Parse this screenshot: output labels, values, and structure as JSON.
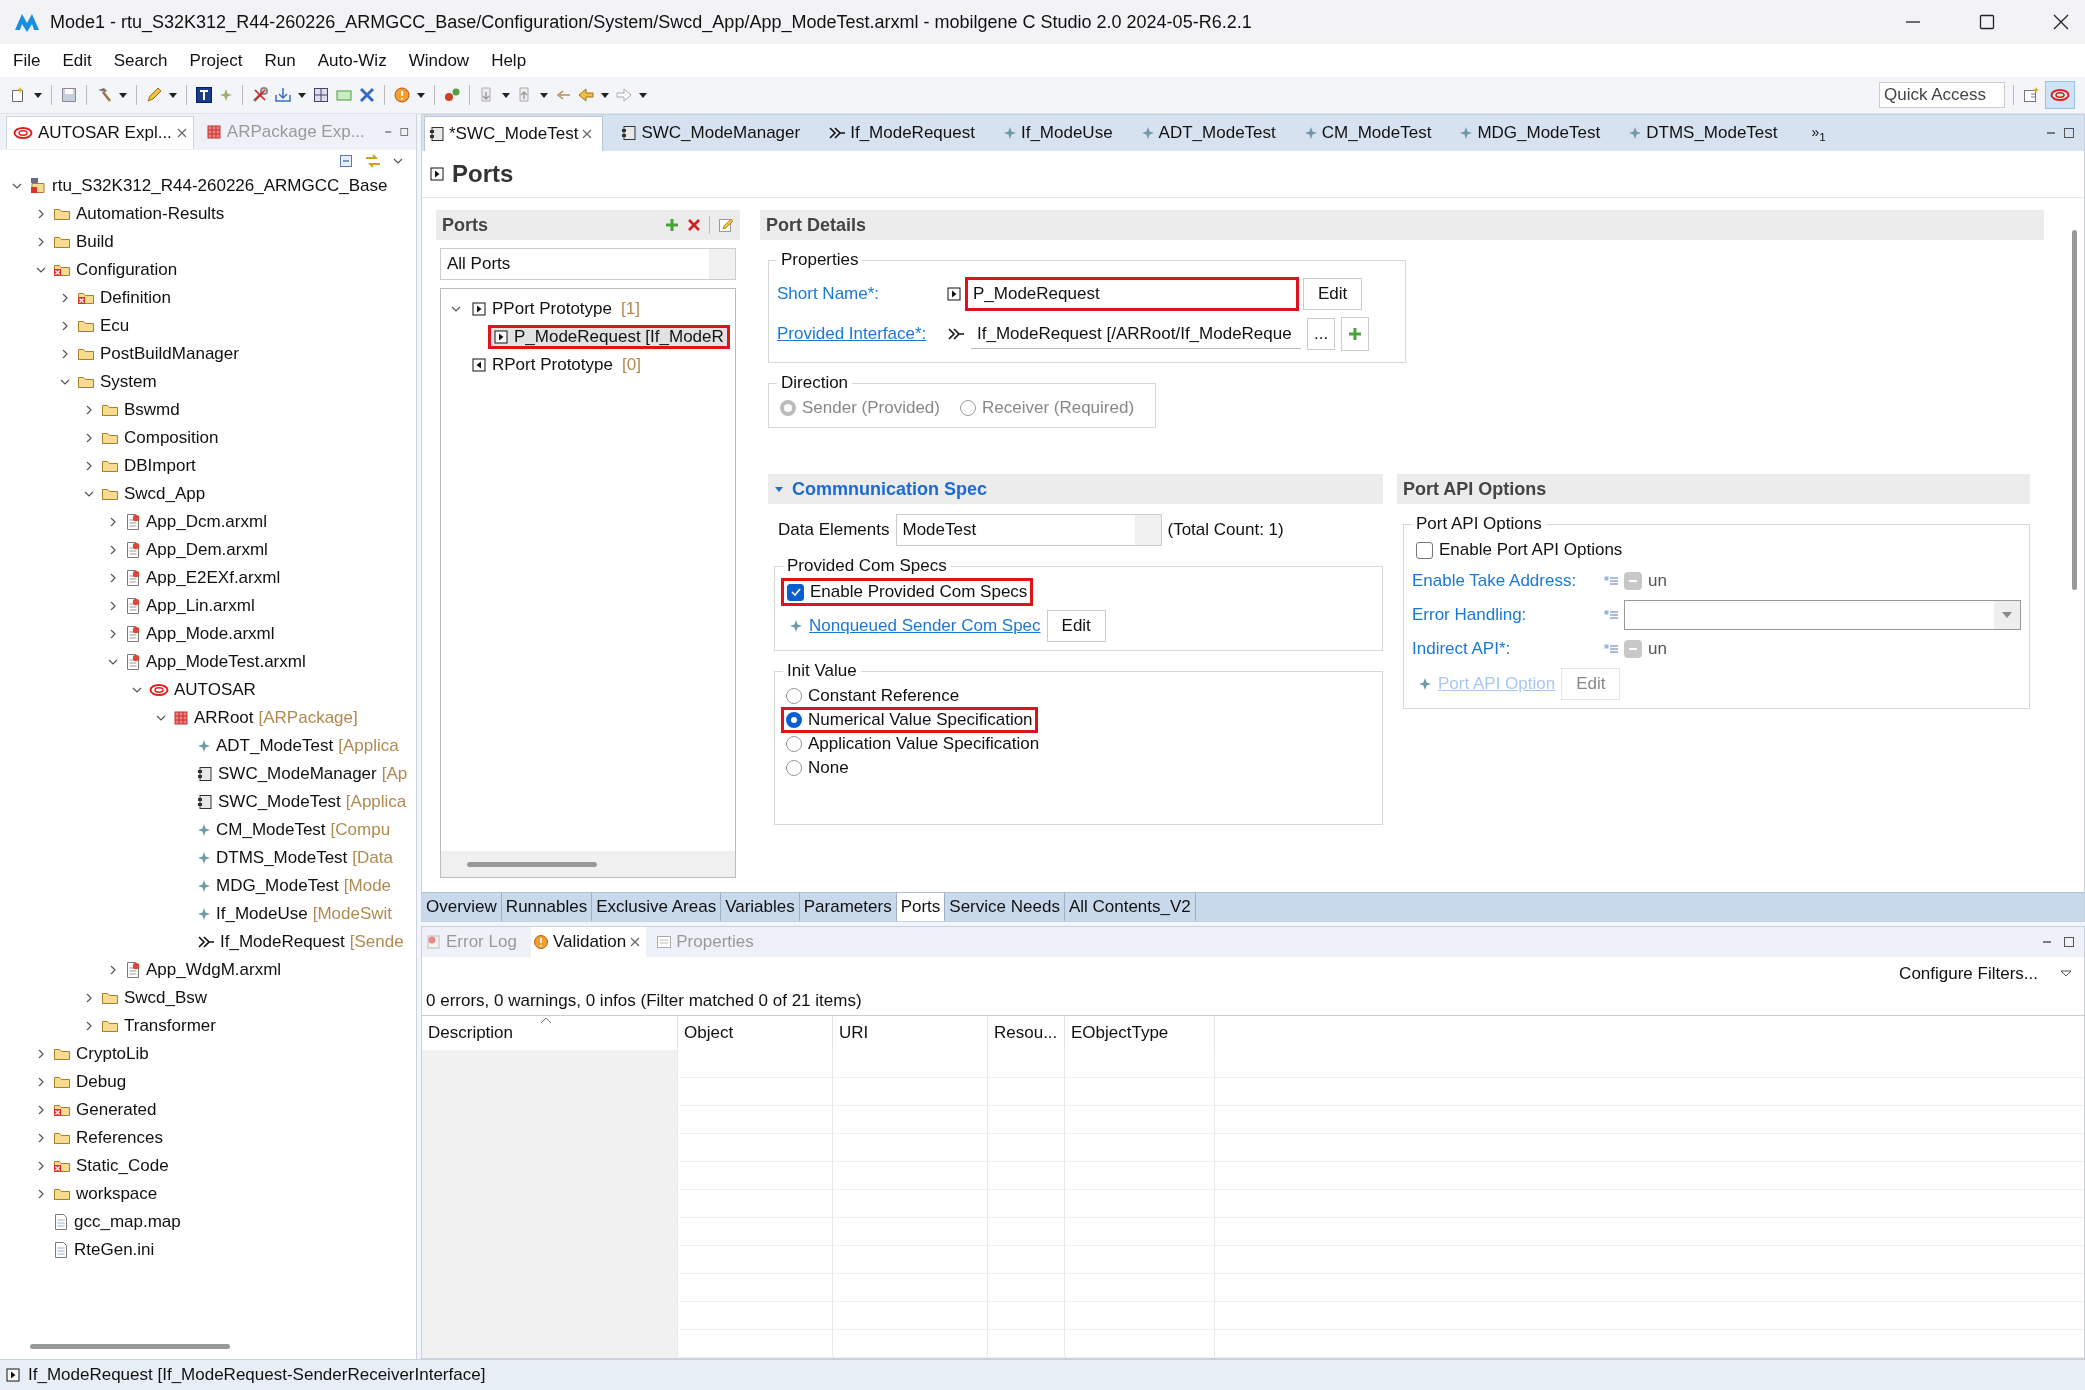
{
  "window": {
    "title": "Mode1 - rtu_S32K312_R44-260226_ARMGCC_Base/Configuration/System/Swcd_App/App_ModeTest.arxml - mobilgene C Studio 2.0 2024-05-R6.2.1"
  },
  "menu": [
    "File",
    "Edit",
    "Search",
    "Project",
    "Run",
    "Auto-Wiz",
    "Window",
    "Help"
  ],
  "quick_access": {
    "placeholder": "Quick Access"
  },
  "explorer": {
    "tabs": [
      {
        "label": "AUTOSAR Expl...",
        "kind": "autosar",
        "selected": true
      },
      {
        "label": "ARPackage Exp...",
        "kind": "package",
        "selected": false
      }
    ],
    "tree": [
      {
        "label": "rtu_S32K312_R44-260226_ARMGCC_Base",
        "kind": "project",
        "expanded": true,
        "children": [
          {
            "label": "Automation-Results",
            "kind": "folder",
            "expanded": false
          },
          {
            "label": "Build",
            "kind": "folder",
            "expanded": false
          },
          {
            "label": "Configuration",
            "kind": "folder-red",
            "expanded": true,
            "children": [
              {
                "label": "Definition",
                "kind": "folder-red",
                "expanded": false
              },
              {
                "label": "Ecu",
                "kind": "folder",
                "expanded": false
              },
              {
                "label": "PostBuildManager",
                "kind": "folder",
                "expanded": false
              },
              {
                "label": "System",
                "kind": "folder",
                "expanded": true,
                "children": [
                  {
                    "label": "Bswmd",
                    "kind": "folder",
                    "expanded": false
                  },
                  {
                    "label": "Composition",
                    "kind": "folder",
                    "expanded": false
                  },
                  {
                    "label": "DBImport",
                    "kind": "folder",
                    "expanded": false
                  },
                  {
                    "label": "Swcd_App",
                    "kind": "folder",
                    "expanded": true,
                    "children": [
                      {
                        "label": "App_Dcm.arxml",
                        "kind": "file",
                        "expanded": false
                      },
                      {
                        "label": "App_Dem.arxml",
                        "kind": "file",
                        "expanded": false
                      },
                      {
                        "label": "App_E2EXf.arxml",
                        "kind": "file",
                        "expanded": false
                      },
                      {
                        "label": "App_Lin.arxml",
                        "kind": "file",
                        "expanded": false
                      },
                      {
                        "label": "App_Mode.arxml",
                        "kind": "file",
                        "expanded": false
                      },
                      {
                        "label": "App_ModeTest.arxml",
                        "kind": "file",
                        "expanded": true,
                        "children": [
                          {
                            "label": "AUTOSAR",
                            "kind": "autosar",
                            "expanded": true,
                            "children": [
                              {
                                "label": "ARRoot",
                                "suffix": "[ARPackage]",
                                "kind": "package",
                                "expanded": true,
                                "children": [
                                  {
                                    "label": "ADT_ModeTest",
                                    "suffix": "[Applica",
                                    "kind": "element"
                                  },
                                  {
                                    "label": "SWC_ModeManager",
                                    "suffix": "[Ap",
                                    "kind": "component"
                                  },
                                  {
                                    "label": "SWC_ModeTest",
                                    "suffix": "[Applica",
                                    "kind": "component"
                                  },
                                  {
                                    "label": "CM_ModeTest",
                                    "suffix": "[Compu",
                                    "kind": "element"
                                  },
                                  {
                                    "label": "DTMS_ModeTest",
                                    "suffix": "[Data",
                                    "kind": "element"
                                  },
                                  {
                                    "label": "MDG_ModeTest",
                                    "suffix": "[Mode",
                                    "kind": "element"
                                  },
                                  {
                                    "label": "If_ModeUse",
                                    "suffix": "[ModeSwit",
                                    "kind": "element"
                                  },
                                  {
                                    "label": "If_ModeRequest",
                                    "suffix": "[Sende",
                                    "kind": "interface"
                                  }
                                ]
                              }
                            ]
                          }
                        ]
                      },
                      {
                        "label": "App_WdgM.arxml",
                        "kind": "file",
                        "expanded": false
                      }
                    ]
                  },
                  {
                    "label": "Swcd_Bsw",
                    "kind": "folder",
                    "expanded": false
                  },
                  {
                    "label": "Transformer",
                    "kind": "folder",
                    "expanded": false
                  }
                ]
              }
            ]
          },
          {
            "label": "CryptoLib",
            "kind": "folder",
            "expanded": false
          },
          {
            "label": "Debug",
            "kind": "folder",
            "expanded": false
          },
          {
            "label": "Generated",
            "kind": "folder-red",
            "expanded": false
          },
          {
            "label": "References",
            "kind": "folder",
            "expanded": false
          },
          {
            "label": "Static_Code",
            "kind": "folder-red",
            "expanded": false
          },
          {
            "label": "workspace",
            "kind": "folder",
            "expanded": false
          },
          {
            "label": "gcc_map.map",
            "kind": "plain-file"
          },
          {
            "label": "RteGen.ini",
            "kind": "plain-file"
          }
        ]
      }
    ]
  },
  "editor": {
    "tabs": [
      {
        "label": "*SWC_ModeTest",
        "kind": "component",
        "selected": true
      },
      {
        "label": "SWC_ModeManager",
        "kind": "component",
        "selected": false
      },
      {
        "label": "If_ModeRequest",
        "kind": "interface",
        "selected": false
      },
      {
        "label": "If_ModeUse",
        "kind": "element",
        "selected": false
      },
      {
        "label": "ADT_ModeTest",
        "kind": "element",
        "selected": false
      },
      {
        "label": "CM_ModeTest",
        "kind": "element",
        "selected": false
      },
      {
        "label": "MDG_ModeTest",
        "kind": "element",
        "selected": false
      },
      {
        "label": "DTMS_ModeTest",
        "kind": "element",
        "selected": false
      }
    ],
    "overflow": "»$_{1}$",
    "page_title": "Ports",
    "ports_panel": {
      "title": "Ports",
      "filter": "All Ports",
      "tree": [
        {
          "label": "PPort Prototype",
          "count": "[1]",
          "kind": "pport",
          "selected": false,
          "highlighted": false,
          "expanded": true,
          "children": [
            {
              "label": "P_ModeRequest [If_ModeR",
              "kind": "pport",
              "selected": true,
              "highlighted": true
            }
          ]
        },
        {
          "label": "RPort Prototype",
          "count": "[0]",
          "kind": "rport",
          "selected": false,
          "highlighted": false
        }
      ]
    },
    "port_details": {
      "title": "Port Details",
      "properties": {
        "title": "Properties",
        "short_name": {
          "label": "Short Name*:",
          "value": "P_ModeRequest",
          "highlighted": true,
          "button": "Edit"
        },
        "provided_interface": {
          "label": "Provided Interface*:",
          "value": "If_ModeRequest [/ARRoot/If_ModeReque",
          "browse": "..."
        }
      },
      "direction": {
        "title": "Direction",
        "disabled": true,
        "options": [
          {
            "label": "Sender (Provided)",
            "selected": true
          },
          {
            "label": "Receiver (Required)",
            "selected": false
          }
        ]
      },
      "com_spec": {
        "title": "Commnunication Spec",
        "expanded": true,
        "data_elements": {
          "label": "Data Elements",
          "value": "ModeTest",
          "total": "(Total Count: 1)"
        },
        "provided": {
          "title": "Provided Com Specs",
          "checkbox": {
            "label": "Enable Provided Com Specs",
            "checked": true,
            "highlighted": true
          },
          "link": "Nonqueued Sender Com Spec",
          "button": "Edit"
        },
        "init_value": {
          "title": "Init Value",
          "options": [
            {
              "label": "Constant Reference",
              "selected": false,
              "highlighted": false
            },
            {
              "label": "Numerical Value Specification",
              "selected": true,
              "highlighted": true
            },
            {
              "label": "Application Value Specification",
              "selected": false,
              "highlighted": false
            },
            {
              "label": "None",
              "selected": false,
              "highlighted": false
            }
          ]
        }
      },
      "api_options": {
        "title": "Port API Options",
        "group": "Port API Options",
        "checkbox": {
          "label": "Enable Port API Options",
          "checked": false
        },
        "rows": [
          {
            "kind": "toggle",
            "label": "Enable Take Address:",
            "value": "un"
          },
          {
            "kind": "dropdown",
            "label": "Error Handling:"
          },
          {
            "kind": "toggle",
            "label": "Indirect API*:",
            "value": "un"
          }
        ],
        "link": {
          "label": "Port API Option",
          "disabled": true
        },
        "button": {
          "label": "Edit",
          "disabled": true
        }
      }
    },
    "page_tabs": [
      {
        "label": "Overview",
        "selected": false
      },
      {
        "label": "Runnables",
        "selected": false
      },
      {
        "label": "Exclusive Areas",
        "selected": false
      },
      {
        "label": "Variables",
        "selected": false
      },
      {
        "label": "Parameters",
        "selected": false
      },
      {
        "label": "Ports",
        "selected": true
      },
      {
        "label": "Service Needs",
        "selected": false
      },
      {
        "label": "All Contents_V2",
        "selected": false
      }
    ]
  },
  "bottom": {
    "tabs": [
      {
        "label": "Error Log",
        "kind": "errorlog",
        "selected": false
      },
      {
        "label": "Validation",
        "kind": "validation",
        "selected": true
      },
      {
        "label": "Properties",
        "kind": "properties",
        "selected": false
      }
    ],
    "configure": "Configure Filters...",
    "summary": "0 errors, 0 warnings, 0 infos (Filter matched 0 of 21 items)",
    "columns": [
      "Description",
      "Object",
      "URI",
      "Resou...",
      "EObjectType"
    ]
  },
  "status_bar": {
    "text": "If_ModeRequest [If_ModeRequest-SenderReceiverInterface]"
  }
}
